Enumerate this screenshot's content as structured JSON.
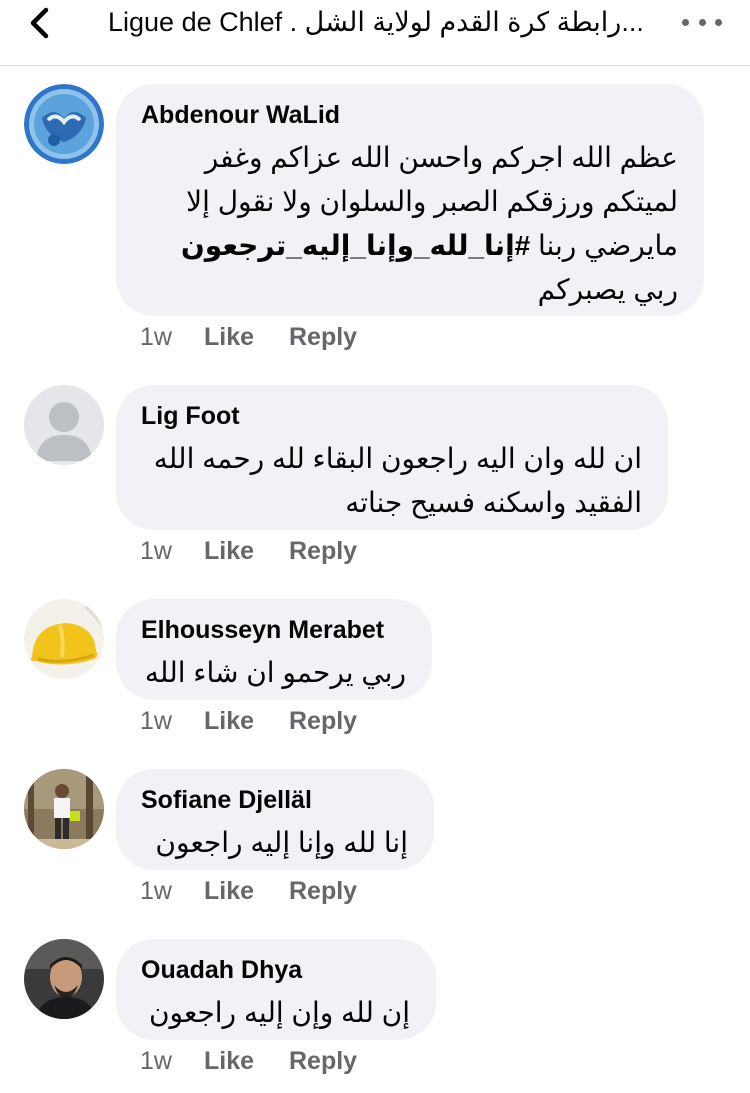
{
  "header": {
    "back_icon": "chevron-left-icon",
    "title": "Ligue de Chlef . رابطة كرة القدم لولاية الشل...",
    "more_icon": "more-horizontal-icon"
  },
  "action_labels": {
    "like": "Like",
    "reply": "Reply"
  },
  "comments": [
    {
      "author": "Abdenour WaLid",
      "text_before": "عظم الله اجركم واحسن الله عزاكم وغفر لميتكم ورزقكم الصبر والسلوان ولا نقول إلا مايرضي ربنا ",
      "hashtag": "#إنا_لله_وإنا_إليه_ترجعون",
      "text_after": " ربي يصبركم",
      "time": "1w"
    },
    {
      "author": "Lig Foot",
      "text": "ان لله وان اليه راجعون البقاء لله رحمه الله الفقيد واسكنه فسيح جناته",
      "time": "1w"
    },
    {
      "author": "Elhousseyn Merabet",
      "text": "ربي يرحمو ان شاء الله",
      "time": "1w"
    },
    {
      "author": "Sofiane Djelläl",
      "text": "إنا لله وإنا إليه راجعون",
      "time": "1w"
    },
    {
      "author": "Ouadah Dhya",
      "text": "إن لله وإن إليه راجعون",
      "time": "1w"
    }
  ],
  "colors": {
    "bubble": "#f0f2f5",
    "secondary_text": "#65676b",
    "primary_text": "#050505",
    "divider": "#dcdde1"
  }
}
